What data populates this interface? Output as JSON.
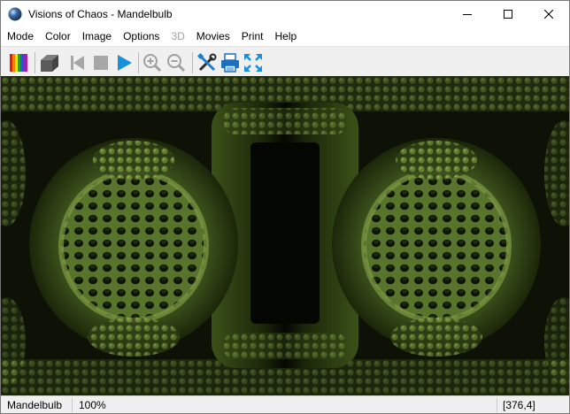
{
  "window": {
    "title": "Visions of Chaos - Mandelbulb",
    "app_icon": "visions-of-chaos-orb-icon",
    "controls": [
      "minimize-icon",
      "maximize-icon",
      "close-icon"
    ]
  },
  "menu": {
    "items": [
      {
        "label": "Mode",
        "enabled": true
      },
      {
        "label": "Color",
        "enabled": true
      },
      {
        "label": "Image",
        "enabled": true
      },
      {
        "label": "Options",
        "enabled": true
      },
      {
        "label": "3D",
        "enabled": false
      },
      {
        "label": "Movies",
        "enabled": true
      },
      {
        "label": "Print",
        "enabled": true
      },
      {
        "label": "Help",
        "enabled": true
      }
    ]
  },
  "toolbar": {
    "buttons": [
      {
        "icon": "color-palette-icon",
        "enabled": true
      },
      {
        "icon": "3d-cube-icon",
        "enabled": true
      },
      {
        "icon": "rewind-icon",
        "enabled": false
      },
      {
        "icon": "stop-icon",
        "enabled": false
      },
      {
        "icon": "play-icon",
        "enabled": true
      },
      {
        "icon": "zoom-in-icon",
        "enabled": false
      },
      {
        "icon": "zoom-out-icon",
        "enabled": false
      },
      {
        "icon": "settings-tools-icon",
        "enabled": true
      },
      {
        "icon": "printer-icon",
        "enabled": true
      },
      {
        "icon": "fullscreen-icon",
        "enabled": true
      }
    ]
  },
  "canvas": {
    "content": "mandelbulb-fractal-render",
    "colors": {
      "background": "#0d1106",
      "dark": "#2a3a14",
      "mid": "#4f6a26",
      "light": "#8aa64e"
    }
  },
  "status": {
    "mode": "Mandelbulb",
    "zoom": "100%",
    "coords": "[376,4]"
  },
  "colors": {
    "toolbar_bg": "#f0f0f0",
    "play_blue": "#1a8fdc",
    "disabled_gray": "#a0a0a0"
  }
}
